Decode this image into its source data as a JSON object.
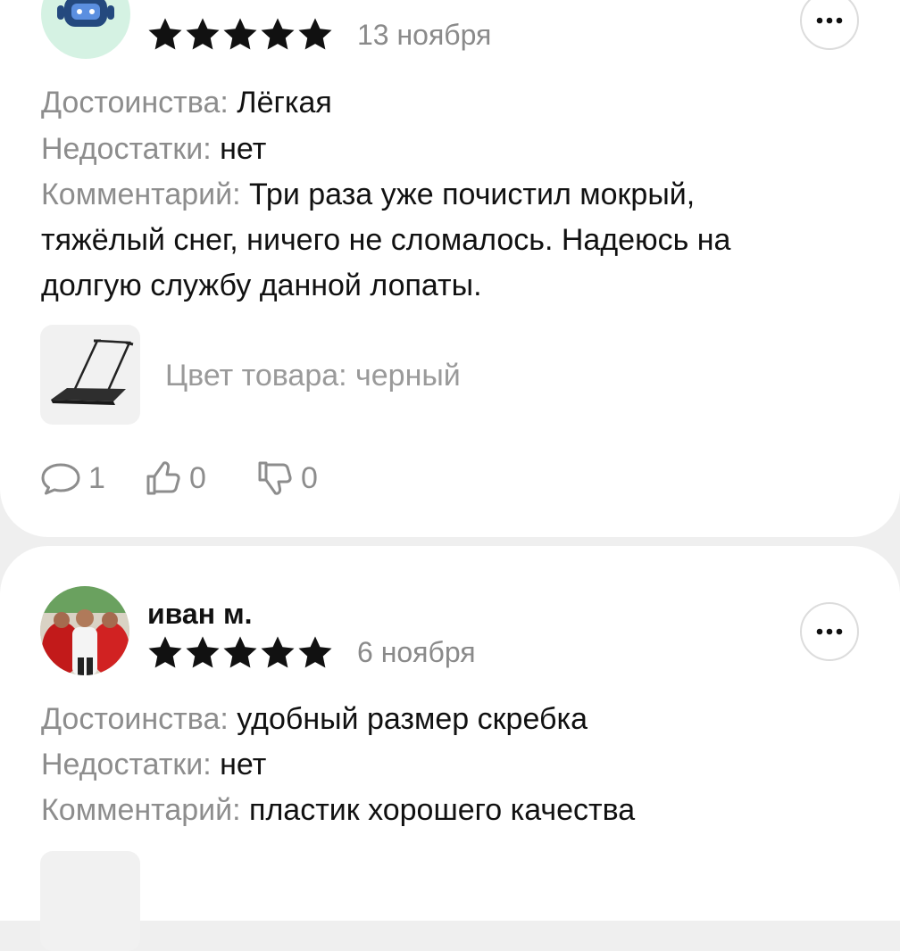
{
  "reviews": [
    {
      "author": "",
      "rating": 5,
      "date": "13 ноября",
      "pros_label": "Достоинства:",
      "pros": "Лёгкая",
      "cons_label": "Недостатки:",
      "cons": "нет",
      "comment_label": "Комментарий:",
      "comment_lines": [
        "Три раза уже почистил мокрый,",
        "тяжёлый снег, ничего не сломалось. Надеюсь на",
        "долгую службу данной лопаты."
      ],
      "variant": "Цвет товара: черный",
      "comments_count": "1",
      "likes": "0",
      "dislikes": "0"
    },
    {
      "author": "иван м.",
      "rating": 5,
      "date": "6 ноября",
      "pros_label": "Достоинства:",
      "pros": "удобный размер скребка",
      "cons_label": "Недостатки:",
      "cons": "нет",
      "comment_label": "Комментарий:",
      "comment_lines": [
        "пластик хорошего качества"
      ]
    }
  ],
  "icons": {
    "star": "star-icon",
    "more": "more-horizontal-icon",
    "comment": "comment-bubble-icon",
    "like": "thumbs-up-icon",
    "dislike": "thumbs-down-icon"
  }
}
